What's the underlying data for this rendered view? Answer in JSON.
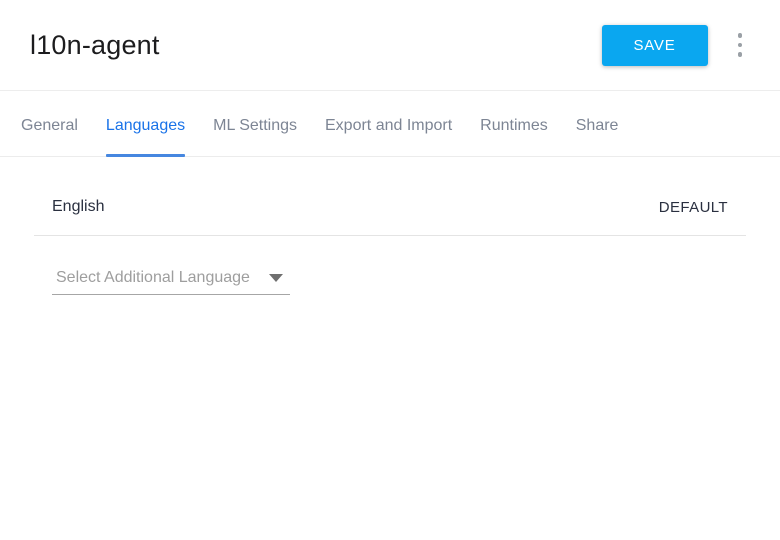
{
  "header": {
    "title": "l10n-agent",
    "save_button_label": "SAVE",
    "menu_icon": "kebab-menu-icon"
  },
  "tabs": [
    {
      "label": "General",
      "active": false
    },
    {
      "label": "Languages",
      "active": true
    },
    {
      "label": "ML Settings",
      "active": false
    },
    {
      "label": "Export and Import",
      "active": false
    },
    {
      "label": "Runtimes",
      "active": false
    },
    {
      "label": "Share",
      "active": false
    }
  ],
  "languages_panel": {
    "default_language": {
      "name": "English",
      "badge": "DEFAULT"
    },
    "language_select": {
      "placeholder": "Select Additional Language",
      "icon": "dropdown-arrow-icon"
    }
  },
  "colors": {
    "save_button_bg": "#0aa7f0",
    "active_tab_text": "#1a73e8",
    "active_tab_underline": "#4687e0",
    "inactive_tab_text": "#7d8594",
    "header_divider": "#ededed",
    "row_divider": "#e4e4e4",
    "body_text": "#2a3040",
    "placeholder_text": "#9e9e9e"
  }
}
